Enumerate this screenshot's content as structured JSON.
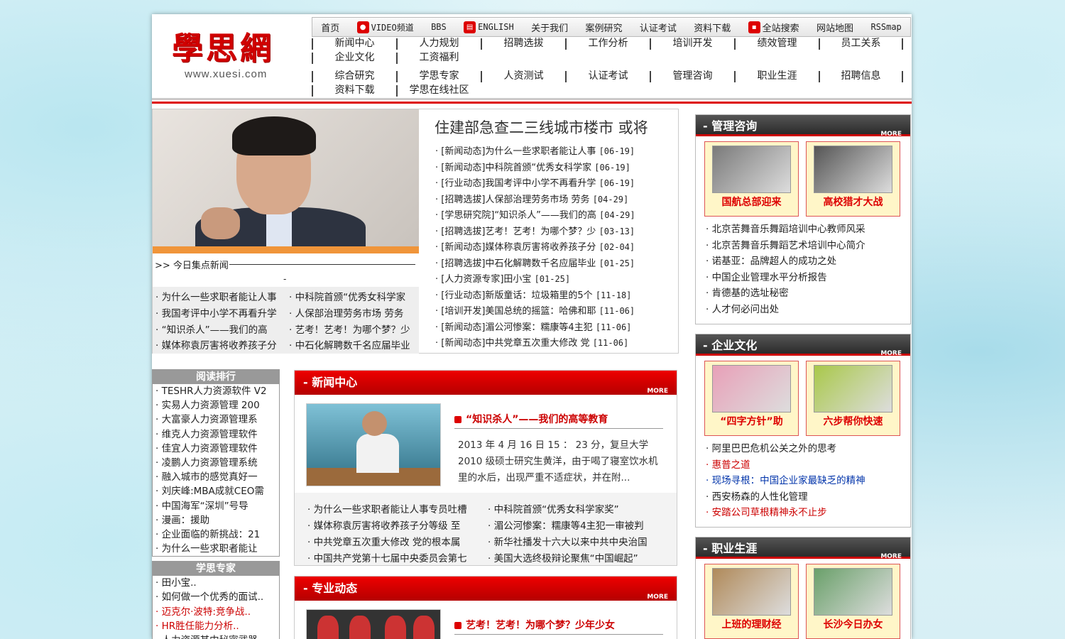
{
  "logo": {
    "main": "學思網",
    "sub": "www.xuesi.com"
  },
  "top_nav": [
    {
      "label": "首页",
      "icon": ""
    },
    {
      "label": "VIDEO频道",
      "icon": "video-icon"
    },
    {
      "label": "BBS",
      "icon": ""
    },
    {
      "label": "ENGLISH",
      "icon": "document-icon"
    },
    {
      "label": "关于我们",
      "icon": ""
    },
    {
      "label": "案例研究",
      "icon": ""
    },
    {
      "label": "认证考试",
      "icon": ""
    },
    {
      "label": "资料下载",
      "icon": ""
    },
    {
      "label": "全站搜索",
      "icon": "chat-icon"
    },
    {
      "label": "网站地图",
      "icon": ""
    },
    {
      "label": "RSSmap",
      "icon": ""
    }
  ],
  "nav_row1": [
    "新闻中心",
    "人力规划",
    "招聘选拔",
    "工作分析",
    "培训开发",
    "绩效管理",
    "员工关系",
    "企业文化",
    "工资福利"
  ],
  "nav_row2": [
    "综合研究",
    "学思专家",
    "人资测试",
    "认证考试",
    "管理咨询",
    "职业生涯",
    "招聘信息",
    "资料下载",
    "学思在线社区"
  ],
  "focus": {
    "title": ">> 今日集点新闻",
    "dash": "-",
    "list": [
      "为什么一些求职者能让人事",
      "中科院首颁“优秀女科学家",
      "我国考评中小学不再看升学",
      "人保部治理劳务市场 劳务",
      "“知识杀人”——我们的高",
      "艺考！艺考！为哪个梦？少",
      "媒体称袁厉害将收养孩子分",
      "中石化解聘数千名应届毕业"
    ]
  },
  "headline": "住建部急查二三线城市楼市 或将",
  "news_list": [
    {
      "text": "[新闻动态]为什么一些求职者能让人事",
      "date": "[06-19]"
    },
    {
      "text": "[新闻动态]中科院首颁“优秀女科学家",
      "date": "[06-19]"
    },
    {
      "text": "[行业动态]我国考评中小学不再看升学",
      "date": "[06-19]"
    },
    {
      "text": "[招聘选拔]人保部治理劳务市场 劳务",
      "date": "[04-29]"
    },
    {
      "text": "[学思研究院]“知识杀人”——我们的高",
      "date": "[04-29]"
    },
    {
      "text": "[招聘选拔]艺考！艺考！为哪个梦？少",
      "date": "[03-13]"
    },
    {
      "text": "[新闻动态]媒体称袁厉害将收养孩子分",
      "date": "[02-04]"
    },
    {
      "text": "[招聘选拔]中石化解聘数千名应届毕业",
      "date": "[01-25]"
    },
    {
      "text": "[人力资源专家]田小宝",
      "date": "[01-25]"
    },
    {
      "text": "[行业动态]新版童话：垃圾箱里的5个",
      "date": "[11-18]"
    },
    {
      "text": "[培训开发]美国总统的摇篮：哈佛和耶",
      "date": "[11-06]"
    },
    {
      "text": "[新闻动态]湄公河惨案：糯康等4主犯",
      "date": "[11-06]"
    },
    {
      "text": "[新闻动态]中共党章五次重大修改 党",
      "date": "[11-06]"
    }
  ],
  "ranking": {
    "title": "阅读排行",
    "items": [
      "TESHR人力资源软件 V2",
      "实易人力资源管理 200",
      "大富豪人力资源管理系",
      "维克人力资源管理软件",
      "佳宜人力资源管理软件",
      "凌鹏人力资源管理系统",
      "融入城市的感觉真好一",
      "刘庆峰:MBA成就CEO需",
      "中国海军“深圳”号导",
      "漫画：援助",
      "企业面临的新挑战：21",
      "为什么一些求职者能让"
    ]
  },
  "experts": {
    "title": "学思专家",
    "items": [
      {
        "text": "田小宝..",
        "red": false
      },
      {
        "text": "如何做一个优秀的面试..",
        "red": false
      },
      {
        "text": "迈克尔·波特:竞争战..",
        "red": true
      },
      {
        "text": "HR胜任能力分析..",
        "red": true
      },
      {
        "text": "人力资源其中秘密武器",
        "red": false
      }
    ]
  },
  "news_center": {
    "title": "新闻中心",
    "more": "MORE",
    "headline": "“知识杀人”——我们的高等教育",
    "desc": "2013 年 4 月 16 日 15 ： 23 分，复旦大学 2010 级硕士研究生黄洋，由于喝了寝室饮水机里的水后，出现严重不适症状，并在附...",
    "list": [
      "为什么一些求职者能让人事专员吐槽",
      "中科院首颁“优秀女科学家奖”",
      "媒体称袁厉害将收养孩子分等级 至",
      "湄公河惨案：糯康等4主犯一审被判",
      "中共党章五次重大修改 党的根本属",
      "新华社播发十六大以来中共中央治国",
      "中国共产党第十七届中央委员会第七",
      "美国大选终极辩论聚焦“中国崛起”"
    ]
  },
  "pro_news": {
    "title": "专业动态",
    "more": "MORE",
    "headline": "艺考！艺考！为哪个梦？少年少女"
  },
  "right_boxes": [
    {
      "title": "管理咨询",
      "more": "MORE",
      "thumbs": [
        {
          "cap": "国航总部迎来",
          "color": "#7a7a7a"
        },
        {
          "cap": "高校猎才大战",
          "color": "#555"
        }
      ],
      "items": [
        {
          "text": "北京苦舞音乐舞蹈培训中心教师风采",
          "cls": ""
        },
        {
          "text": "北京苦舞音乐舞蹈艺术培训中心简介",
          "cls": ""
        },
        {
          "text": "诺基亚：品牌超人的成功之处",
          "cls": ""
        },
        {
          "text": "中国企业管理水平分析报告",
          "cls": ""
        },
        {
          "text": "肯德基的选址秘密",
          "cls": ""
        },
        {
          "text": "人才何必问出处",
          "cls": ""
        }
      ]
    },
    {
      "title": "企业文化",
      "more": "MORE",
      "thumbs": [
        {
          "cap": "“四字方针”助",
          "color": "#e8a0b8"
        },
        {
          "cap": "六步帮你快速",
          "color": "#a9c84a"
        }
      ],
      "items": [
        {
          "text": "阿里巴巴危机公关之外的思考",
          "cls": ""
        },
        {
          "text": "惠普之道",
          "cls": "red"
        },
        {
          "text": "现场寻根：中国企业家最缺乏的精神",
          "cls": "blue"
        },
        {
          "text": "西安杨森的人性化管理",
          "cls": ""
        },
        {
          "text": "安踏公司草根精神永不止步",
          "cls": "red"
        }
      ]
    },
    {
      "title": "职业生涯",
      "more": "MORE",
      "thumbs": [
        {
          "cap": "上班的理财经",
          "color": "#b08a5a"
        },
        {
          "cap": "长沙今日办女",
          "color": "#6aa06a"
        }
      ],
      "items": []
    }
  ]
}
